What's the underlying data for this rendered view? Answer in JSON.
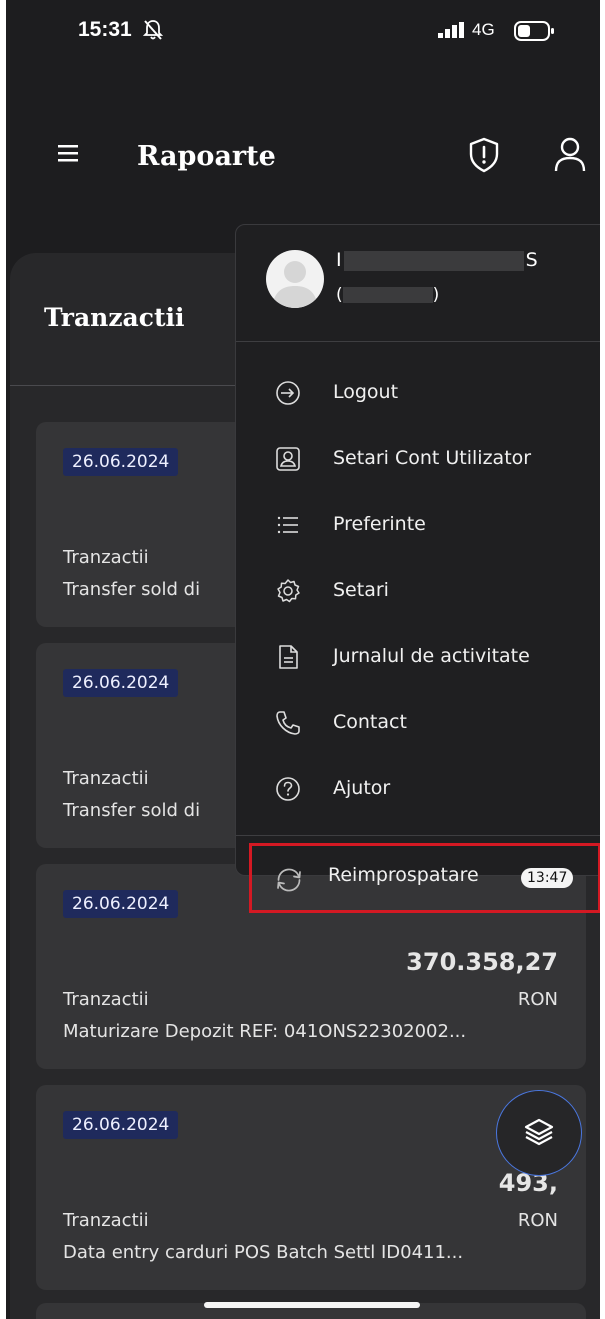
{
  "status_bar": {
    "time": "15:31",
    "network": "4G",
    "icons": [
      "bell-slash-icon",
      "signal-icon",
      "battery-icon"
    ]
  },
  "header": {
    "title": "Rapoarte",
    "icons": [
      "hamburger-icon",
      "shield-alert-icon",
      "user-icon"
    ]
  },
  "page": {
    "section_title": "Tranzactii"
  },
  "cards": [
    {
      "date": "26.06.2024",
      "amount": "",
      "category": "Tranzactii",
      "currency": "",
      "description": "Transfer sold di"
    },
    {
      "date": "26.06.2024",
      "amount": "",
      "category": "Tranzactii",
      "currency": "",
      "description": "Transfer sold di"
    },
    {
      "date": "26.06.2024",
      "amount": "370.358,27",
      "category": "Tranzactii",
      "currency": "RON",
      "description": "Maturizare Depozit REF: 041ONS22302002..."
    },
    {
      "date": "26.06.2024",
      "amount": "493,",
      "category": "Tranzactii",
      "currency": "RON",
      "description": "Data entry carduri POS Batch Settl ID0411..."
    }
  ],
  "user_menu": {
    "user_name_start": "I",
    "user_name_end": "S",
    "user_id_start": "(",
    "user_id_end": ")",
    "items": [
      {
        "label": "Logout",
        "icon": "logout-icon"
      },
      {
        "label": "Setari Cont Utilizator",
        "icon": "user-account-icon"
      },
      {
        "label": "Preferinte",
        "icon": "list-icon"
      },
      {
        "label": "Setari",
        "icon": "gear-icon"
      },
      {
        "label": "Jurnalul de activitate",
        "icon": "document-icon"
      },
      {
        "label": "Contact",
        "icon": "phone-icon"
      },
      {
        "label": "Ajutor",
        "icon": "help-icon"
      }
    ],
    "refresh": {
      "label": "Reimprospatare",
      "badge": "13:47",
      "icon": "refresh-icon"
    }
  },
  "fab": {
    "icon": "layers-icon"
  },
  "colors": {
    "background": "#1d1d1f",
    "card": "#353537",
    "date_badge": "#1f2a5c",
    "highlight_border": "#d41923",
    "fab_border": "#4a77e0"
  }
}
